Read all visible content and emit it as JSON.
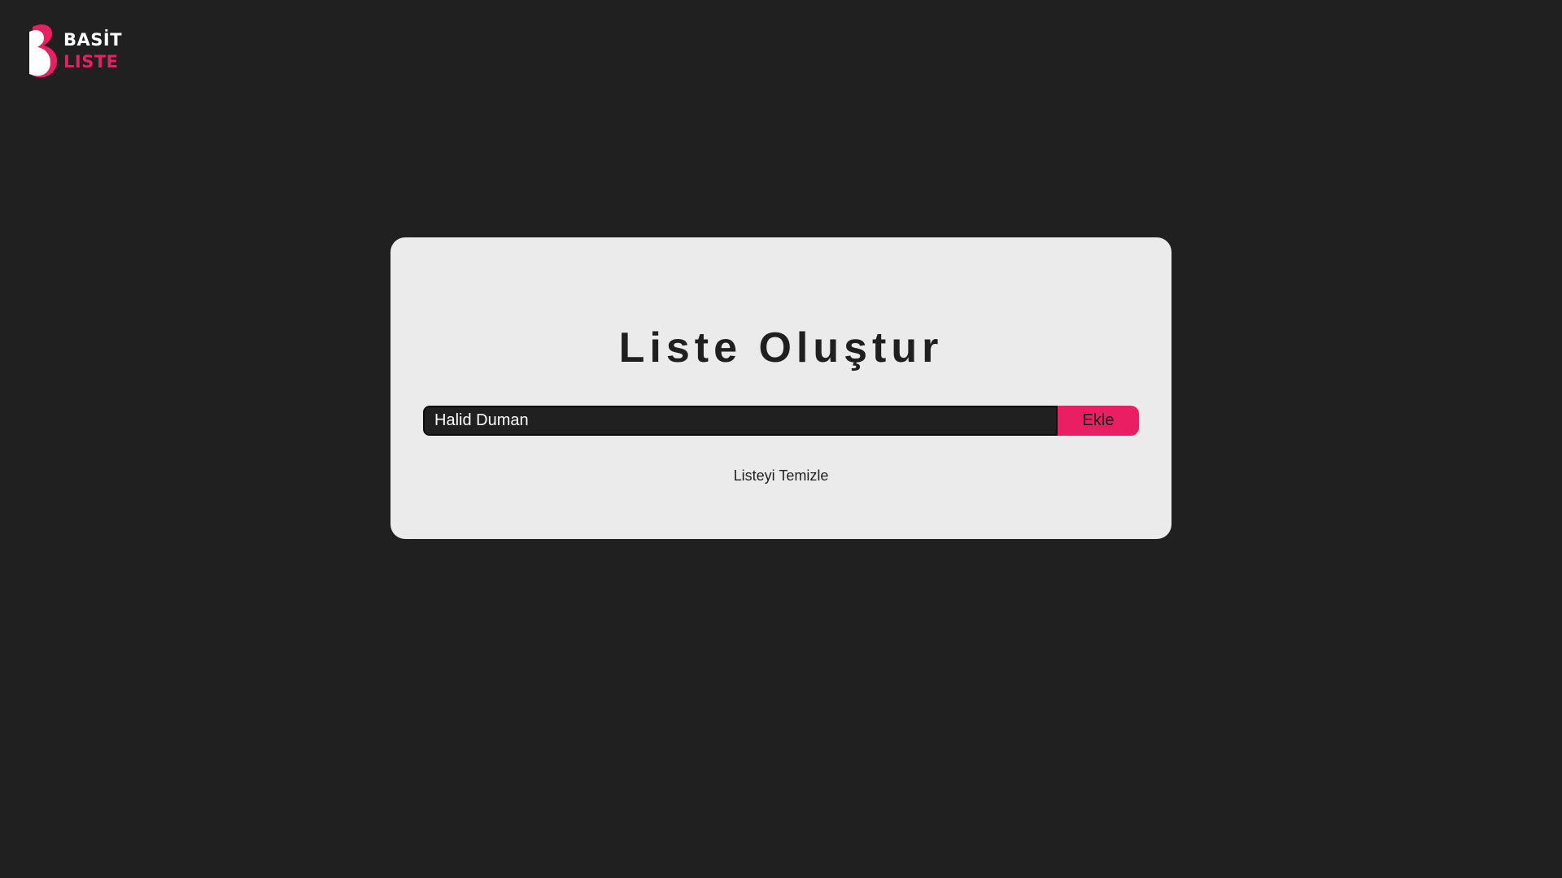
{
  "logo": {
    "line1": "BASİT",
    "line2": "LISTE",
    "icon": "b-logo-mark-icon",
    "accent_color": "#e91e63"
  },
  "card": {
    "title": "Liste Oluştur",
    "input_value": "Halid Duman",
    "add_button_label": "Ekle",
    "clear_link_label": "Listeyi Temizle"
  },
  "colors": {
    "background": "#202020",
    "card": "#ebebeb",
    "accent": "#e91e63"
  }
}
